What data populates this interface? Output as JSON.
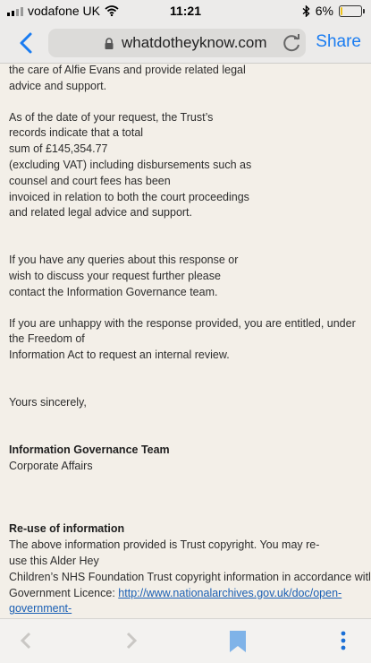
{
  "status_bar": {
    "carrier": "vodafone UK",
    "time": "11:21",
    "battery_percent_label": "6%",
    "battery_level": 0.06
  },
  "browser": {
    "url": "whatdotheyknow.com",
    "share_label": "Share"
  },
  "content": {
    "para1": [
      "the care of Alfie Evans and provide related legal",
      "advice and support."
    ],
    "para2": [
      "As of the date of your request, the Trust’s",
      "records indicate that a total",
      "sum of £145,354.77",
      "(excluding VAT) including disbursements such as",
      "counsel and court fees has been",
      "invoiced in relation to both the court proceedings",
      "and related legal advice and support."
    ],
    "para3": [
      "If you have any queries about this response or",
      "wish to discuss your request further please",
      "contact the Information Governance team."
    ],
    "para4": [
      "If you are unhappy with the response provided, you are entitled, under",
      "the Freedom of",
      "Information Act to request an internal review."
    ],
    "closing": "Yours sincerely,",
    "signature_team": "Information Governance Team",
    "signature_dept": "Corporate Affairs",
    "reuse_heading": "Re-use of information",
    "reuse_lines": [
      "The above information provided is Trust copyright. You may re-",
      "use this Alder Hey",
      "Children’s NHS Foundation Trust copyright information in accordance with the Open",
      "Government Licence: "
    ],
    "reuse_link_1": "http://www.nationalarchives.gov.uk/doc/open-",
    "reuse_link_2": "government-"
  }
}
